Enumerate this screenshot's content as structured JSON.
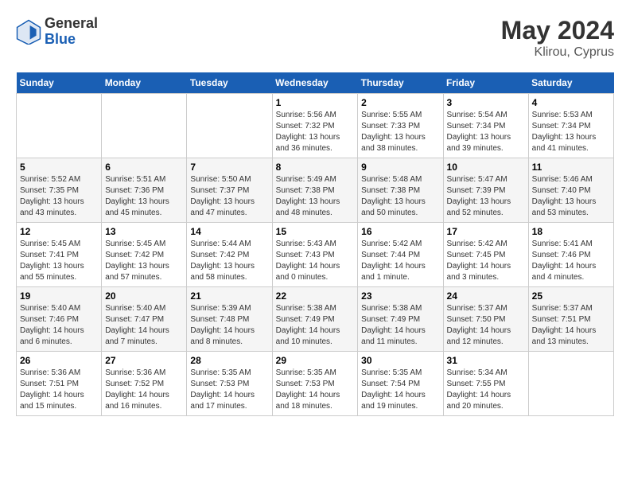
{
  "header": {
    "logo_general": "General",
    "logo_blue": "Blue",
    "month_year": "May 2024",
    "location": "Klirou, Cyprus"
  },
  "days_of_week": [
    "Sunday",
    "Monday",
    "Tuesday",
    "Wednesday",
    "Thursday",
    "Friday",
    "Saturday"
  ],
  "weeks": [
    [
      {
        "day": "",
        "content": ""
      },
      {
        "day": "",
        "content": ""
      },
      {
        "day": "",
        "content": ""
      },
      {
        "day": "1",
        "content": "Sunrise: 5:56 AM\nSunset: 7:32 PM\nDaylight: 13 hours and 36 minutes."
      },
      {
        "day": "2",
        "content": "Sunrise: 5:55 AM\nSunset: 7:33 PM\nDaylight: 13 hours and 38 minutes."
      },
      {
        "day": "3",
        "content": "Sunrise: 5:54 AM\nSunset: 7:34 PM\nDaylight: 13 hours and 39 minutes."
      },
      {
        "day": "4",
        "content": "Sunrise: 5:53 AM\nSunset: 7:34 PM\nDaylight: 13 hours and 41 minutes."
      }
    ],
    [
      {
        "day": "5",
        "content": "Sunrise: 5:52 AM\nSunset: 7:35 PM\nDaylight: 13 hours and 43 minutes."
      },
      {
        "day": "6",
        "content": "Sunrise: 5:51 AM\nSunset: 7:36 PM\nDaylight: 13 hours and 45 minutes."
      },
      {
        "day": "7",
        "content": "Sunrise: 5:50 AM\nSunset: 7:37 PM\nDaylight: 13 hours and 47 minutes."
      },
      {
        "day": "8",
        "content": "Sunrise: 5:49 AM\nSunset: 7:38 PM\nDaylight: 13 hours and 48 minutes."
      },
      {
        "day": "9",
        "content": "Sunrise: 5:48 AM\nSunset: 7:38 PM\nDaylight: 13 hours and 50 minutes."
      },
      {
        "day": "10",
        "content": "Sunrise: 5:47 AM\nSunset: 7:39 PM\nDaylight: 13 hours and 52 minutes."
      },
      {
        "day": "11",
        "content": "Sunrise: 5:46 AM\nSunset: 7:40 PM\nDaylight: 13 hours and 53 minutes."
      }
    ],
    [
      {
        "day": "12",
        "content": "Sunrise: 5:45 AM\nSunset: 7:41 PM\nDaylight: 13 hours and 55 minutes."
      },
      {
        "day": "13",
        "content": "Sunrise: 5:45 AM\nSunset: 7:42 PM\nDaylight: 13 hours and 57 minutes."
      },
      {
        "day": "14",
        "content": "Sunrise: 5:44 AM\nSunset: 7:42 PM\nDaylight: 13 hours and 58 minutes."
      },
      {
        "day": "15",
        "content": "Sunrise: 5:43 AM\nSunset: 7:43 PM\nDaylight: 14 hours and 0 minutes."
      },
      {
        "day": "16",
        "content": "Sunrise: 5:42 AM\nSunset: 7:44 PM\nDaylight: 14 hours and 1 minute."
      },
      {
        "day": "17",
        "content": "Sunrise: 5:42 AM\nSunset: 7:45 PM\nDaylight: 14 hours and 3 minutes."
      },
      {
        "day": "18",
        "content": "Sunrise: 5:41 AM\nSunset: 7:46 PM\nDaylight: 14 hours and 4 minutes."
      }
    ],
    [
      {
        "day": "19",
        "content": "Sunrise: 5:40 AM\nSunset: 7:46 PM\nDaylight: 14 hours and 6 minutes."
      },
      {
        "day": "20",
        "content": "Sunrise: 5:40 AM\nSunset: 7:47 PM\nDaylight: 14 hours and 7 minutes."
      },
      {
        "day": "21",
        "content": "Sunrise: 5:39 AM\nSunset: 7:48 PM\nDaylight: 14 hours and 8 minutes."
      },
      {
        "day": "22",
        "content": "Sunrise: 5:38 AM\nSunset: 7:49 PM\nDaylight: 14 hours and 10 minutes."
      },
      {
        "day": "23",
        "content": "Sunrise: 5:38 AM\nSunset: 7:49 PM\nDaylight: 14 hours and 11 minutes."
      },
      {
        "day": "24",
        "content": "Sunrise: 5:37 AM\nSunset: 7:50 PM\nDaylight: 14 hours and 12 minutes."
      },
      {
        "day": "25",
        "content": "Sunrise: 5:37 AM\nSunset: 7:51 PM\nDaylight: 14 hours and 13 minutes."
      }
    ],
    [
      {
        "day": "26",
        "content": "Sunrise: 5:36 AM\nSunset: 7:51 PM\nDaylight: 14 hours and 15 minutes."
      },
      {
        "day": "27",
        "content": "Sunrise: 5:36 AM\nSunset: 7:52 PM\nDaylight: 14 hours and 16 minutes."
      },
      {
        "day": "28",
        "content": "Sunrise: 5:35 AM\nSunset: 7:53 PM\nDaylight: 14 hours and 17 minutes."
      },
      {
        "day": "29",
        "content": "Sunrise: 5:35 AM\nSunset: 7:53 PM\nDaylight: 14 hours and 18 minutes."
      },
      {
        "day": "30",
        "content": "Sunrise: 5:35 AM\nSunset: 7:54 PM\nDaylight: 14 hours and 19 minutes."
      },
      {
        "day": "31",
        "content": "Sunrise: 5:34 AM\nSunset: 7:55 PM\nDaylight: 14 hours and 20 minutes."
      },
      {
        "day": "",
        "content": ""
      }
    ]
  ]
}
